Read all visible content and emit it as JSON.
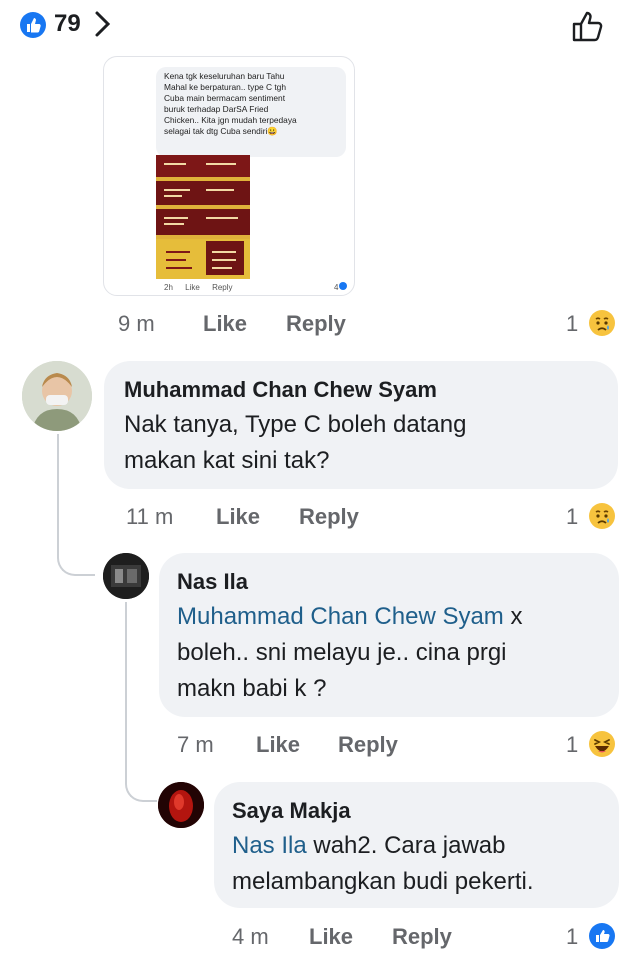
{
  "header": {
    "like_count": "79",
    "chevron_glyph": ">"
  },
  "embedded": {
    "lines": [
      "Kena tgk keseluruhan baru Tahu",
      "Mahal ke berpaturan.. type C tgh",
      "Cuba main bermacam sentiment",
      "buruk terhadap DarSA Fried",
      "Chicken.. Kita jgn mudah terpedaya",
      "selagai tak dtg Cuba sendiri"
    ],
    "emoji": "😀",
    "time": "2h",
    "like": "Like",
    "reply": "Reply",
    "react_count": "4"
  },
  "comments": [
    {
      "time": "9 m",
      "like": "Like",
      "reply": "Reply",
      "reaction_count": "1",
      "reaction": "sad"
    },
    {
      "author": "Muhammad Chan Chew Syam",
      "lines": [
        "Nak tanya, Type C boleh datang",
        "makan kat sini tak?"
      ],
      "time": "11 m",
      "like": "Like",
      "reply": "Reply",
      "reaction_count": "1",
      "reaction": "sad"
    },
    {
      "author": "Nas Ila",
      "mention": "Muhammad Chan Chew Syam",
      "first_line_rest": " x",
      "lines": [
        "boleh.. sni melayu je.. cina prgi",
        "makn babi k ?"
      ],
      "time": "7 m",
      "like": "Like",
      "reply": "Reply",
      "reaction_count": "1",
      "reaction": "haha"
    },
    {
      "author": "Saya Makja",
      "mention": "Nas Ila",
      "first_line_rest": " wah2. Cara jawab",
      "lines": [
        "melambangkan budi pekerti."
      ],
      "time": "4 m",
      "like": "Like",
      "reply": "Reply",
      "reaction_count": "1",
      "reaction": "like"
    }
  ],
  "colors": {
    "facebook_blue": "#1877f2",
    "bubble_bg": "#f0f2f5",
    "mention": "#1f5f8b",
    "meta_gray": "#65676b"
  }
}
